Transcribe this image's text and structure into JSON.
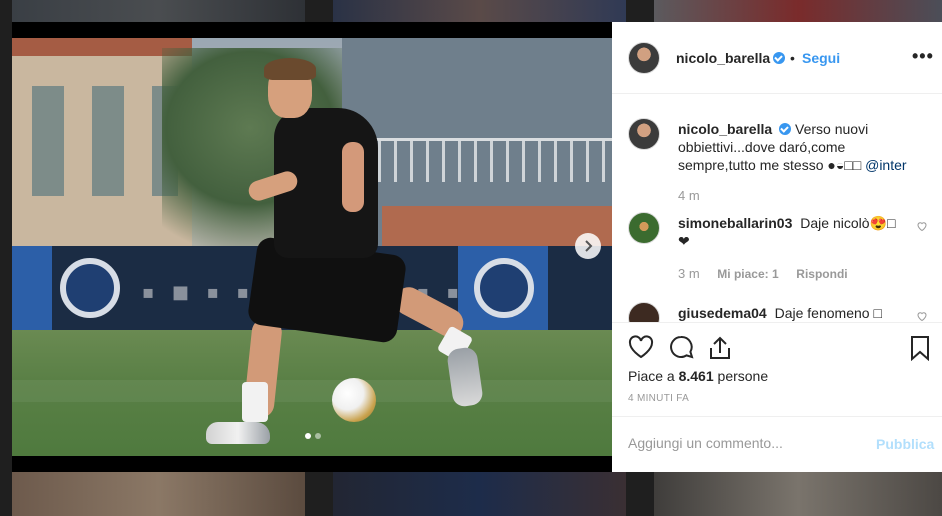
{
  "post": {
    "author": "nicolo_barella",
    "follow_label": "Segui",
    "follow_separator": "•",
    "more_label": "•••",
    "likes_prefix": "Piace a ",
    "likes_count": "8.461",
    "likes_suffix": " persone",
    "timestamp": "4 MINUTI FA",
    "carousel": {
      "total": 2,
      "active": 1
    }
  },
  "caption": {
    "username": "nicolo_barella",
    "text": "Verso nuovi obbiettivi...dove daró,come sempre,tutto me stesso ●◒□□ ",
    "mention": "@inter",
    "time": "4 m"
  },
  "comments": [
    {
      "username": "simoneballarin03",
      "text": "Daje nicolò😍□ ❤",
      "time": "3 m",
      "likes": "Mi piace: 1",
      "reply": "Rispondi"
    },
    {
      "username": "giusedema04",
      "text": "Daje fenomeno □"
    }
  ],
  "composer": {
    "placeholder": "Aggiungi un commento...",
    "publish_label": "Pubblica"
  },
  "colors": {
    "accent": "#3897f0",
    "publish_disabled": "#b2dffc",
    "text": "#262626",
    "muted": "#999999"
  },
  "icons": [
    "verified-icon",
    "heart-icon",
    "comment-icon",
    "share-icon",
    "bookmark-icon",
    "chevron-right-icon"
  ]
}
